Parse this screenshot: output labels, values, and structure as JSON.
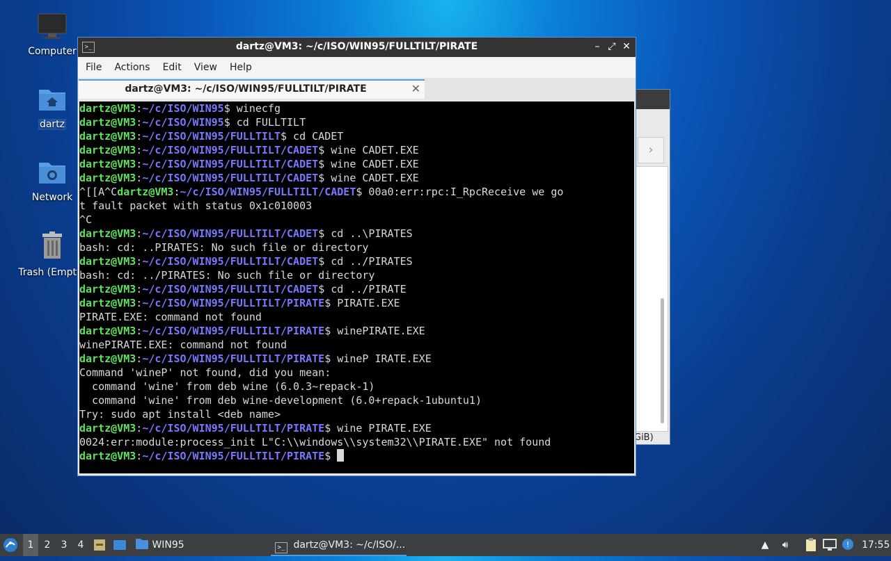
{
  "desktop": {
    "icons": [
      {
        "label": "Computer"
      },
      {
        "label": "dartz"
      },
      {
        "label": "Network"
      },
      {
        "label": "Trash (Empty)"
      }
    ]
  },
  "background_window": {
    "visible_text": "GiB)"
  },
  "terminal": {
    "title": "dartz@VM3: ~/c/ISO/WIN95/FULLTILT/PIRATE",
    "menu": [
      "File",
      "Actions",
      "Edit",
      "View",
      "Help"
    ],
    "tab_label": "dartz@VM3: ~/c/ISO/WIN95/FULLTILT/PIRATE",
    "lines": [
      {
        "user": "dartz@VM3",
        "path": "~/c/ISO/WIN95",
        "cmd": " winecfg"
      },
      {
        "user": "dartz@VM3",
        "path": "~/c/ISO/WIN95",
        "cmd": " cd FULLTILT"
      },
      {
        "user": "dartz@VM3",
        "path": "~/c/ISO/WIN95/FULLTILT",
        "cmd": " cd CADET"
      },
      {
        "user": "dartz@VM3",
        "path": "~/c/ISO/WIN95/FULLTILT/CADET",
        "cmd": " wine CADET.EXE"
      },
      {
        "user": "dartz@VM3",
        "path": "~/c/ISO/WIN95/FULLTILT/CADET",
        "cmd": " wine CADET.EXE"
      },
      {
        "user": "dartz@VM3",
        "path": "~/c/ISO/WIN95/FULLTILT/CADET",
        "cmd": " wine CADET.EXE"
      },
      {
        "pre": "^[[A^C",
        "user": "dartz@VM3",
        "path": "~/c/ISO/WIN95/FULLTILT/CADET",
        "cmd": " 00a0:err:rpc:I_RpcReceive we go"
      },
      {
        "text": "t fault packet with status 0x1c010003"
      },
      {
        "text": "^C"
      },
      {
        "user": "dartz@VM3",
        "path": "~/c/ISO/WIN95/FULLTILT/CADET",
        "cmd": " cd ..\\PIRATES"
      },
      {
        "text": "bash: cd: ..PIRATES: No such file or directory"
      },
      {
        "user": "dartz@VM3",
        "path": "~/c/ISO/WIN95/FULLTILT/CADET",
        "cmd": " cd ../PIRATES"
      },
      {
        "text": "bash: cd: ../PIRATES: No such file or directory"
      },
      {
        "user": "dartz@VM3",
        "path": "~/c/ISO/WIN95/FULLTILT/CADET",
        "cmd": " cd ../PIRATE"
      },
      {
        "user": "dartz@VM3",
        "path": "~/c/ISO/WIN95/FULLTILT/PIRATE",
        "cmd": " PIRATE.EXE"
      },
      {
        "text": "PIRATE.EXE: command not found"
      },
      {
        "user": "dartz@VM3",
        "path": "~/c/ISO/WIN95/FULLTILT/PIRATE",
        "cmd": " winePIRATE.EXE"
      },
      {
        "text": "winePIRATE.EXE: command not found"
      },
      {
        "user": "dartz@VM3",
        "path": "~/c/ISO/WIN95/FULLTILT/PIRATE",
        "cmd": " wineP IRATE.EXE"
      },
      {
        "text": "Command 'wineP' not found, did you mean:"
      },
      {
        "text": "  command 'wine' from deb wine (6.0.3~repack-1)"
      },
      {
        "text": "  command 'wine' from deb wine-development (6.0+repack-1ubuntu1)"
      },
      {
        "text": "Try: sudo apt install <deb name>"
      },
      {
        "user": "dartz@VM3",
        "path": "~/c/ISO/WIN95/FULLTILT/PIRATE",
        "cmd": " wine PIRATE.EXE"
      },
      {
        "text": "0024:err:module:process_init L\"C:\\\\windows\\\\system32\\\\PIRATE.EXE\" not found"
      },
      {
        "user": "dartz@VM3",
        "path": "~/c/ISO/WIN95/FULLTILT/PIRATE",
        "cmd": " ",
        "cursor": true
      }
    ]
  },
  "taskbar": {
    "workspaces": [
      "1",
      "2",
      "3",
      "4"
    ],
    "active_workspace": "1",
    "folder_label": "WIN95",
    "task_label": "dartz@VM3: ~/c/ISO/...",
    "clock": "17:55"
  },
  "colors": {
    "prompt_user": "#5fe35f",
    "prompt_path": "#7a78ff",
    "accent": "#4f9ee0"
  }
}
